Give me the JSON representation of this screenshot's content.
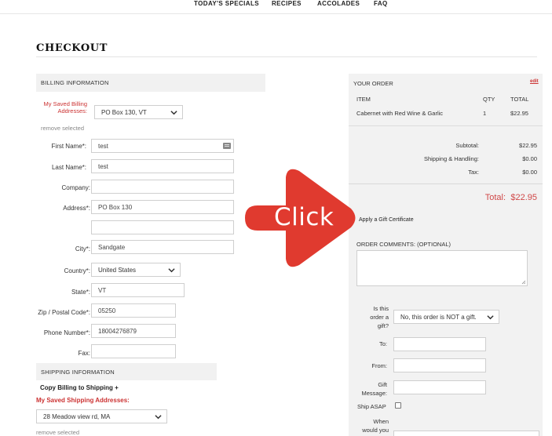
{
  "nav": {
    "items": [
      "TODAY'S SPECIALS",
      "RECIPES",
      "ACCOLADES",
      "FAQ"
    ]
  },
  "page_title": "CHECKOUT",
  "billing": {
    "section_title": "BILLING INFORMATION",
    "saved_label": "My Saved Billing Addresses:",
    "saved_value": "PO Box 130, VT",
    "remove_link": "remove selected",
    "first_name_label": "First Name",
    "first_name": "test",
    "last_name_label": "Last Name",
    "last_name": "test",
    "company_label": "Company:",
    "company": "",
    "address_label": "Address",
    "address1": "PO Box 130",
    "address2": "",
    "city_label": "City",
    "city": "Sandgate",
    "country_label": "Country",
    "country": "United States",
    "state_label": "State",
    "state": "VT",
    "zip_label": "Zip / Postal Code",
    "zip": "05250",
    "phone_label": "Phone Number",
    "phone": "18004276879",
    "fax_label": "Fax:",
    "fax": ""
  },
  "shipping": {
    "section_title": "SHIPPING INFORMATION",
    "copy_link": "Copy Billing to Shipping +",
    "saved_label": "My Saved Shipping Addresses:",
    "saved_value": "28 Meadow view rd, MA",
    "remove_link": "remove selected"
  },
  "order": {
    "title": "YOUR ORDER",
    "edit": "edit",
    "col_item": "ITEM",
    "col_qty": "QTY",
    "col_total": "TOTAL",
    "item_name": "Cabernet with Red Wine & Garlic",
    "item_qty": "1",
    "item_total": "$22.95",
    "subtotal_label": "Subtotal:",
    "subtotal": "$22.95",
    "shipping_label": "Shipping & Handling:",
    "shipping": "$0.00",
    "tax_label": "Tax:",
    "tax": "$0.00",
    "total_label": "Total:",
    "total": "$22.95",
    "gift_cert": "Apply a Gift Certificate",
    "comments_label": "ORDER COMMENTS:",
    "comments_optional": "(OPTIONAL)",
    "gift_q_line1": "Is this",
    "gift_q_line2": "order a",
    "gift_q_line3": "gift?",
    "gift_select": "No, this order is NOT a gift.",
    "to_label": "To:",
    "from_label": "From:",
    "gift_msg_line1": "Gift",
    "gift_msg_line2": "Message:",
    "ship_asap": "Ship ASAP",
    "when_line1": "When",
    "when_line2": "would you"
  },
  "overlay": {
    "text": "Click",
    "color": "#e03a2f"
  },
  "required_marker": "*:"
}
